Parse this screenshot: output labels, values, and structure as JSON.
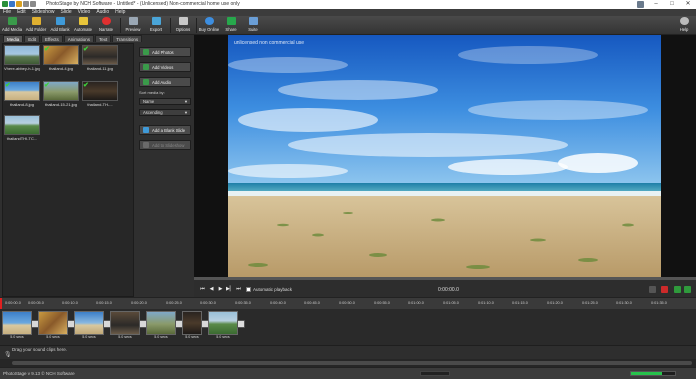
{
  "window": {
    "title": "PhotoStage by NCH Software - Untitled* - (Unlicensed) Non-commercial home use only",
    "controls": [
      "–",
      "□",
      "✕"
    ]
  },
  "menu": [
    "File",
    "Edit",
    "Slideshow",
    "Slide",
    "Video",
    "Audio",
    "Help"
  ],
  "toolbar": {
    "add_media": "Add Media",
    "add_folder": "Add Folder",
    "add_blank": "Add Blank",
    "automate": "Automate",
    "narrate": "Narrate",
    "preview": "Preview",
    "export": "Export",
    "options": "Options",
    "buy_online": "Buy Online",
    "share": "Share",
    "suite": "Suite",
    "help": "Help"
  },
  "tabs": [
    "Media",
    "Edit",
    "Effects",
    "Animations",
    "Text",
    "Transitions"
  ],
  "media_items": [
    {
      "caption": "Vhere-abbey-h-1.jpg",
      "checked": false
    },
    {
      "caption": "thailand-4.jpg",
      "checked": true
    },
    {
      "caption": "thailand-11.jpg",
      "checked": true
    },
    {
      "caption": "thailand-8.jpg",
      "checked": true
    },
    {
      "caption": "thailand-15-21.jpg",
      "checked": true
    },
    {
      "caption": "thailand-TH-...",
      "checked": true
    },
    {
      "caption": "thailandTHI-TC...",
      "checked": false
    }
  ],
  "side_buttons": {
    "add_photos": "Add Photos",
    "add_videos": "Add Videos",
    "add_audio": "Add Audio",
    "sort_label": "Sort media by:",
    "sort_by": "Name",
    "sort_order": "Ascending",
    "add_blank_slide": "Add a Blank Slide",
    "add_to_slideshow": "Add to Slideshow"
  },
  "preview": {
    "watermark": "unlicensed non commercial use",
    "autoplay_label": "Automatic playback",
    "timecode": "0:00:00.0"
  },
  "ruler_ticks": [
    "0:00:00.0",
    "0:00:05.0",
    "0:00:10.0",
    "0:00:15.0",
    "0:00:20.0",
    "0:00:25.0",
    "0:00:30.0",
    "0:00:35.0",
    "0:00:40.0",
    "0:00:45.0",
    "0:00:50.0",
    "0:00:55.0",
    "0:01:00.0",
    "0:01:05.0",
    "0:01:10.0",
    "0:01:15.0",
    "0:01:20.0",
    "0:01:25.0",
    "0:01:30.0",
    "0:01:35.0"
  ],
  "clips": [
    {
      "duration": "5.0 secs"
    },
    {
      "duration": "5.0 secs"
    },
    {
      "duration": "5.0 secs"
    },
    {
      "duration": "5.0 secs"
    },
    {
      "duration": "5.0 secs"
    },
    {
      "duration": "5.0 secs"
    },
    {
      "duration": "5.0 secs"
    }
  ],
  "audio_track": {
    "hint": "Drag your sound clips here."
  },
  "status": {
    "text": "PhotoStage v 9.13 © NCH Software",
    "progress": 0.7
  },
  "colors": {
    "accent": "#3d8ee0",
    "record": "#e03030",
    "ok": "#27c24c"
  }
}
